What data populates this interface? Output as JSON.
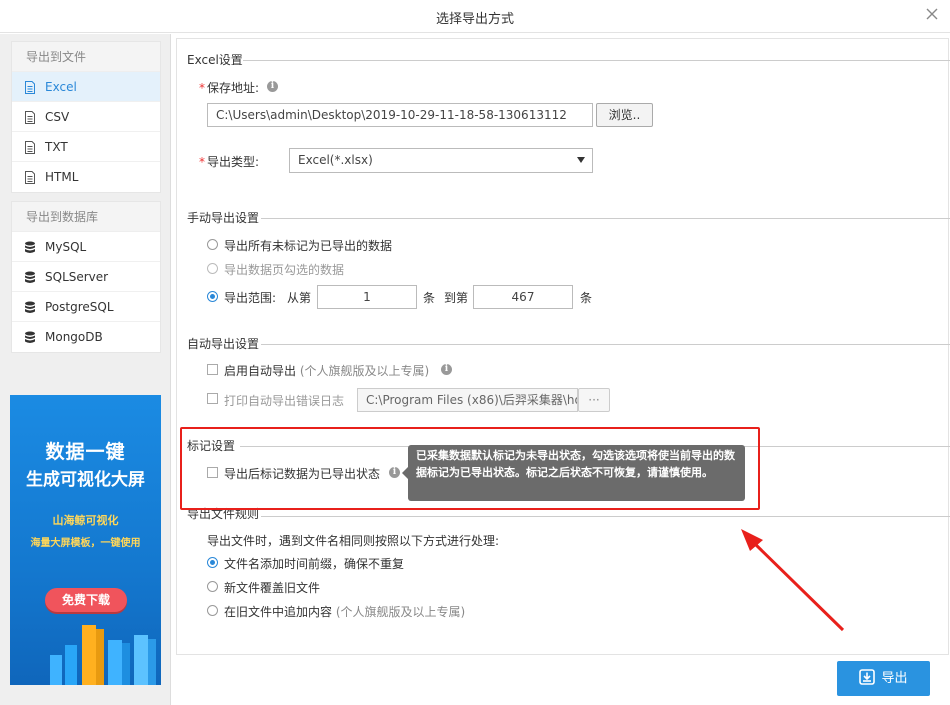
{
  "window": {
    "title": "选择导出方式"
  },
  "sidebar": {
    "file_group": {
      "heading": "导出到文件",
      "items": [
        {
          "label": "Excel",
          "icon": "file-icon",
          "active": true
        },
        {
          "label": "CSV",
          "icon": "file-icon"
        },
        {
          "label": "TXT",
          "icon": "file-icon"
        },
        {
          "label": "HTML",
          "icon": "file-icon"
        }
      ]
    },
    "db_group": {
      "heading": "导出到数据库",
      "items": [
        {
          "label": "MySQL",
          "icon": "database-icon"
        },
        {
          "label": "SQLServer",
          "icon": "database-icon"
        },
        {
          "label": "PostgreSQL",
          "icon": "database-icon"
        },
        {
          "label": "MongoDB",
          "icon": "database-icon"
        }
      ]
    },
    "ad": {
      "line1": "数据一键",
      "line2": "生成可视化大屏",
      "sub1": "山海鲸可视化",
      "sub2": "海量大屏模板，一键使用",
      "button": "免费下载"
    }
  },
  "excel": {
    "heading": "Excel设置",
    "save_label": "保存地址:",
    "save_path": "C:\\Users\\admin\\Desktop\\2019-10-29-11-18-58-130613112",
    "browse": "浏览..",
    "type_label": "导出类型:",
    "type_value": "Excel(*.xlsx)"
  },
  "manual": {
    "heading": "手动导出设置",
    "opt1": "导出所有未标记为已导出的数据",
    "opt2": "导出数据页勾选的数据",
    "opt3": "导出范围:",
    "from_label": "从第",
    "from_value": "1",
    "unit1": "条",
    "to_label": "到第",
    "to_value": "467",
    "unit2": "条"
  },
  "auto": {
    "heading": "自动导出设置",
    "enable": "启用自动导出",
    "enable_note": "(个人旗舰版及以上专属)",
    "log": "打印自动导出错误日志",
    "log_path": "C:\\Program Files (x86)\\后羿采集器\\ho",
    "more": "···"
  },
  "mark": {
    "heading": "标记设置",
    "option": "导出后标记数据为已导出状态",
    "tooltip": "已采集数据默认标记为未导出状态，勾选该选项将使当前导出的数据标记为已导出状态。标记之后状态不可恢复，请谨慎使用。"
  },
  "rules": {
    "heading": "导出文件规则",
    "desc": "导出文件时，遇到文件名相同则按照以下方式进行处理:",
    "opt1": "文件名添加时间前缀，确保不重复",
    "opt2": "新文件覆盖旧文件",
    "opt3": "在旧文件中追加内容",
    "opt3_note": "(个人旗舰版及以上专属)"
  },
  "footer": {
    "export": "导出"
  },
  "colors": {
    "accent": "#2a88d8",
    "highlight": "#e8201b",
    "button": "#2a93e0"
  }
}
